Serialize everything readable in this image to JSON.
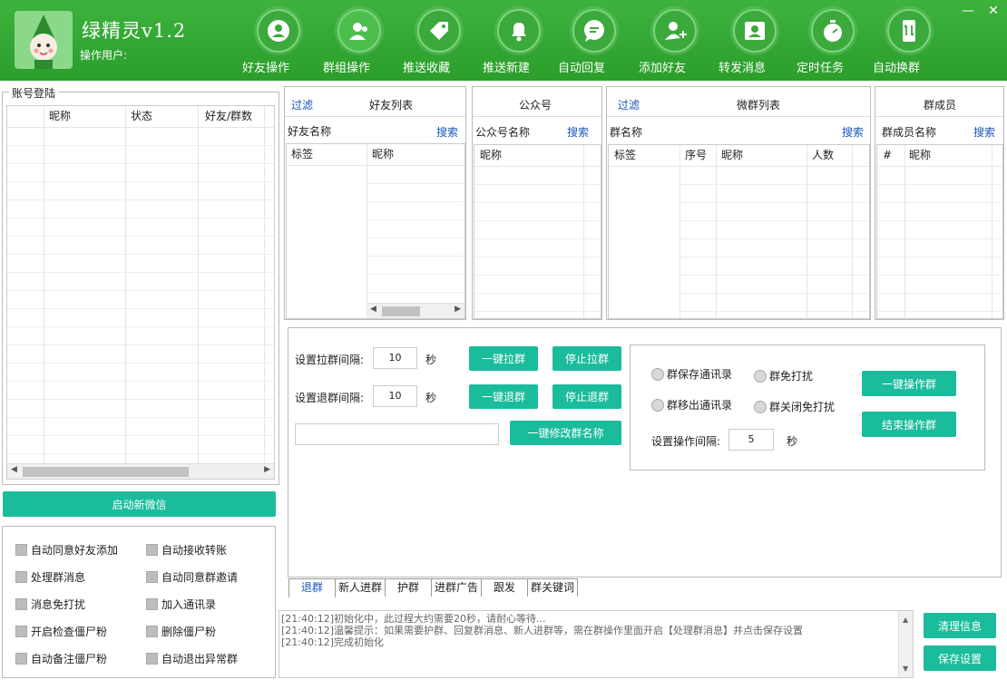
{
  "app": {
    "title": "绿精灵v1.2",
    "user_label": "操作用户:"
  },
  "window_controls": {
    "minimize": "—",
    "close": "✕"
  },
  "toolbar": [
    {
      "label": "好友操作",
      "icon": "user-circle-icon"
    },
    {
      "label": "群组操作",
      "icon": "group-user-icon"
    },
    {
      "label": "推送收藏",
      "icon": "tag-icon"
    },
    {
      "label": "推送新建",
      "icon": "bell-icon"
    },
    {
      "label": "自动回复",
      "icon": "chat-bubble-icon"
    },
    {
      "label": "添加好友",
      "icon": "add-user-icon"
    },
    {
      "label": "转发消息",
      "icon": "contact-card-icon"
    },
    {
      "label": "定时任务",
      "icon": "stopwatch-icon"
    },
    {
      "label": "自动换群",
      "icon": "phone-swap-icon"
    }
  ],
  "account": {
    "group_title": "账号登陆",
    "columns": [
      "昵称",
      "状态",
      "好友/群数"
    ],
    "start_button": "启动新微信"
  },
  "options": [
    "自动同意好友添加",
    "自动接收转账",
    "处理群消息",
    "自动同意群邀请",
    "消息免打扰",
    "加入通讯录",
    "开启检查僵尸粉",
    "删除僵尸粉",
    "自动备注僵尸粉",
    "自动退出异常群"
  ],
  "friends": {
    "filter": "过滤",
    "title": "好友列表",
    "search_label": "好友名称",
    "search": "搜索",
    "columns": [
      "标签",
      "昵称"
    ]
  },
  "official": {
    "title": "公众号",
    "search_label": "公众号名称",
    "search": "搜索",
    "columns": [
      "昵称"
    ]
  },
  "groups": {
    "filter": "过滤",
    "title": "微群列表",
    "search_label": "群名称",
    "search": "搜索",
    "columns": [
      "标签",
      "序号",
      "昵称",
      "人数"
    ]
  },
  "members": {
    "title": "群成员",
    "search_label": "群成员名称",
    "search": "搜索",
    "columns": [
      "#",
      "昵称"
    ]
  },
  "ops": {
    "pull_interval_label": "设置拉群间隔:",
    "pull_interval": "10",
    "unit_sec": "秒",
    "quit_interval_label": "设置退群间隔:",
    "quit_interval": "10",
    "pull_btn": "一键拉群",
    "stop_pull_btn": "停止拉群",
    "quit_btn": "一键退群",
    "stop_quit_btn": "停止退群",
    "rename_btn": "一键修改群名称",
    "rename_value": "",
    "radio_save": "群保存通讯录",
    "radio_dnd": "群免打扰",
    "radio_remove": "群移出通讯录",
    "radio_undnd": "群关闭免打扰",
    "op_group_btn": "一键操作群",
    "end_op_btn": "结束操作群",
    "op_interval_label": "设置操作间隔:",
    "op_interval": "5"
  },
  "tabs": [
    "退群",
    "新人进群",
    "护群",
    "进群广告",
    "跟发",
    "群关键词"
  ],
  "log": {
    "lines": [
      "[21:40:12]初始化中，此过程大约需要20秒，请耐心等待...",
      "[21:40:12]温馨提示：如果需要护群、回复群消息、新人进群等，需在群操作里面开启【处理群消息】并点击保存设置",
      "[21:40:12]完成初始化"
    ],
    "clear_btn": "清理信息",
    "save_btn": "保存设置"
  }
}
